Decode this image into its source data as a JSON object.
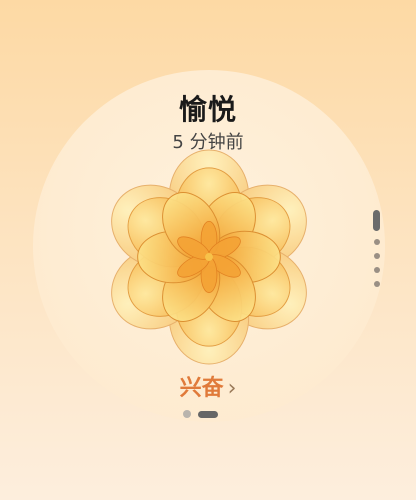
{
  "mood": {
    "title": "愉悦",
    "time_ago": "5 分钟前",
    "next_label": "兴奋",
    "icon": "golden-flower-icon"
  },
  "colors": {
    "petal_light": "#fde08a",
    "petal_deep": "#f5a623",
    "accent_text": "#e07a3a"
  },
  "navigation": {
    "chevron": "›",
    "page_dots": 2,
    "active_page": 2
  }
}
